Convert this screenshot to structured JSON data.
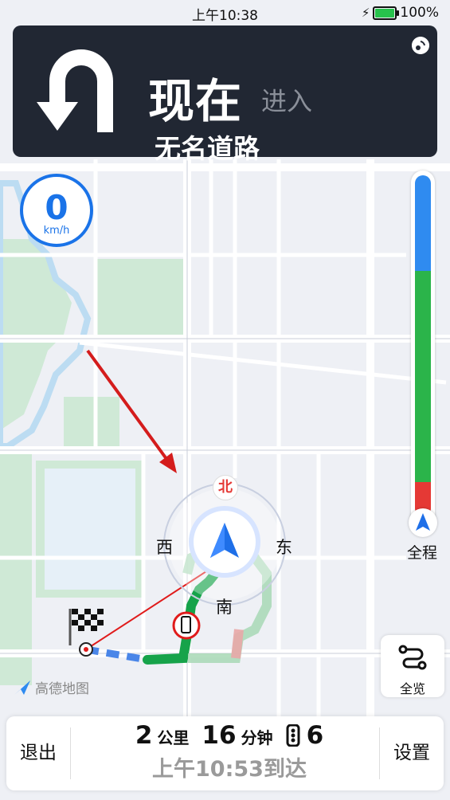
{
  "status_bar": {
    "time": "上午10:38",
    "battery": "100%",
    "battery_level": 1.0
  },
  "guidance": {
    "action_icon": "u-turn-icon",
    "now_label": "现在",
    "action_label": "进入",
    "road_name": "无名道路"
  },
  "speed": {
    "value": "0",
    "unit": "km/h"
  },
  "route_progress": {
    "overview_label": "全程",
    "segments": [
      {
        "color": "#2f8bf0",
        "fraction": 0.28
      },
      {
        "color": "#2bb44a",
        "fraction": 0.62
      },
      {
        "color": "#e53935",
        "fraction": 0.1
      }
    ]
  },
  "compass": {
    "north": "北",
    "south": "南",
    "east": "东",
    "west": "西"
  },
  "map_buttons": {
    "full_view_label": "全览"
  },
  "logo": {
    "text": "高德地图"
  },
  "bottom_bar": {
    "exit_label": "退出",
    "settings_label": "设置",
    "distance_value": "2",
    "distance_unit": "公里",
    "time_value": "16",
    "time_unit": "分钟",
    "lights_value": "6",
    "eta": "上午10:53到达"
  },
  "colors": {
    "accent": "#1a73e8",
    "panel": "#212733",
    "traffic_green": "#2bb44a",
    "traffic_red": "#e53935"
  }
}
